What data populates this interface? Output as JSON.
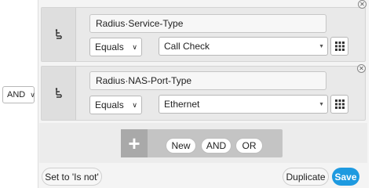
{
  "root_operator": {
    "value": "AND"
  },
  "conditions": [
    {
      "attribute": "Radius·Service-Type",
      "operator": "Equals",
      "value": "Call Check"
    },
    {
      "attribute": "Radius·NAS-Port-Type",
      "operator": "Equals",
      "value": "Ethernet"
    }
  ],
  "add_bar": {
    "new_label": "New",
    "and_label": "AND",
    "or_label": "OR"
  },
  "footer": {
    "set_is_not_label": "Set to 'Is not'",
    "duplicate_label": "Duplicate",
    "save_label": "Save"
  },
  "icons": {
    "handle": "drag-handle-icon",
    "close": "close-icon",
    "grid": "grid-picker-icon",
    "add": "plus-icon"
  },
  "colors": {
    "save_button": "#1e9ae0",
    "background_panel": "#f4f4f4",
    "condition_bg": "#e9e9e9"
  }
}
